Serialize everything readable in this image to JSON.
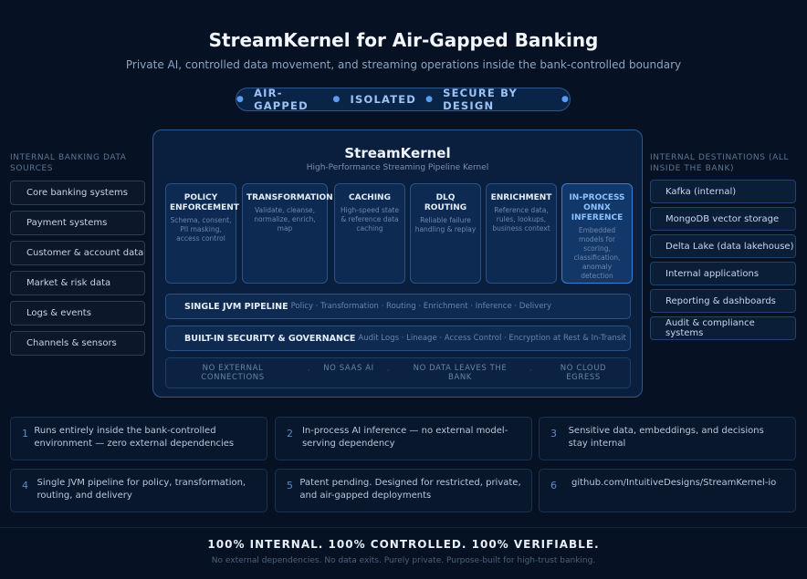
{
  "header": {
    "title": "StreamKernel for Air-Gapped Banking",
    "subtitle": "Private AI, controlled data movement, and streaming operations inside the bank-controlled boundary",
    "pill": [
      "AIR-GAPPED",
      "ISOLATED",
      "SECURE BY DESIGN"
    ]
  },
  "sources": {
    "heading": "INTERNAL BANKING DATA SOURCES",
    "items": [
      "Core banking systems",
      "Payment systems",
      "Customer & account data",
      "Market & risk data",
      "Logs & events",
      "Channels & sensors"
    ]
  },
  "destinations": {
    "heading": "INTERNAL DESTINATIONS (ALL INSIDE THE BANK)",
    "items": [
      "Kafka (internal)",
      "MongoDB vector storage",
      "Delta Lake (data lakehouse)",
      "Internal applications",
      "Reporting & dashboards",
      "Audit & compliance systems"
    ]
  },
  "kernel": {
    "title": "StreamKernel",
    "subtitle": "High-Performance Streaming Pipeline Kernel",
    "modules": [
      {
        "title": "POLICY ENFORCEMENT",
        "desc": "Schema, consent, PII masking, access control"
      },
      {
        "title": "TRANSFORMATION",
        "desc": "Validate, cleanse, normalize, enrich, map"
      },
      {
        "title": "CACHING",
        "desc": "High-speed state & reference data caching"
      },
      {
        "title": "DLQ ROUTING",
        "desc": "Reliable failure handling & replay"
      },
      {
        "title": "ENRICHMENT",
        "desc": "Reference data, rules, lookups, business context"
      },
      {
        "title": "IN-PROCESS ONNX INFERENCE",
        "desc": "Embedded models for scoring, classification, anomaly detection"
      }
    ],
    "pipeline": {
      "title": "SINGLE JVM PIPELINE",
      "desc": "Policy · Transformation · Routing · Enrichment · Inference · Delivery"
    },
    "security": {
      "title": "BUILT-IN SECURITY & GOVERNANCE",
      "desc": "Audit Logs · Lineage · Access Control · Encryption at Rest & In-Transit"
    },
    "negatives": [
      "NO EXTERNAL CONNECTIONS",
      "NO SAAS AI",
      "NO DATA LEAVES THE BANK",
      "NO CLOUD EGRESS"
    ]
  },
  "cards": [
    {
      "n": "1",
      "text": "Runs entirely inside the bank-controlled environment — zero external dependencies"
    },
    {
      "n": "2",
      "text": "In-process AI inference — no external model-serving dependency"
    },
    {
      "n": "3",
      "text": "Sensitive data, embeddings, and decisions stay internal"
    },
    {
      "n": "4",
      "text": "Single JVM pipeline for policy, transformation, routing, and delivery"
    },
    {
      "n": "5",
      "text": "Patent pending. Designed for restricted, private, and air-gapped deployments"
    },
    {
      "n": "6",
      "text": "github.com/IntuitiveDesigns/StreamKernel-io"
    }
  ],
  "footer": {
    "title": "100% INTERNAL. 100% CONTROLLED. 100% VERIFIABLE.",
    "subtitle": "No external dependencies. No data exits. Purely private. Purpose-built for high-trust banking."
  }
}
